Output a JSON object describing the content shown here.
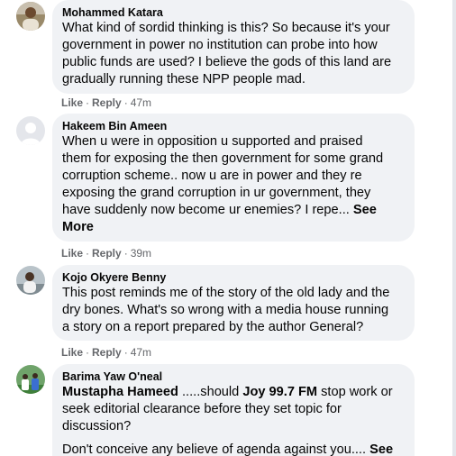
{
  "comments": [
    {
      "author": "Mohammed Katara",
      "avatar": "profile-photo-icon",
      "lines": [
        "What kind of sordid thinking is this? So because it's your",
        "government in power no institution can probe into how",
        "public funds are used? I believe the gods of this land are",
        "gradually running these NPP people mad."
      ],
      "like_label": "Like",
      "reply_label": "Reply",
      "time": "47m"
    },
    {
      "author": "Hakeem Bin Ameen",
      "avatar": "default-avatar-icon",
      "lines": [
        "When u were in opposition u supported and praised",
        "them for exposing the then government for some grand",
        "corruption scheme.. now u are in power and they re",
        "exposing the grand corruption in ur government, they",
        "have suddenly now become ur enemies? I repe..."
      ],
      "see_more_part1": "See",
      "see_more_part2": "More",
      "like_label": "Like",
      "reply_label": "Reply",
      "time": "39m"
    },
    {
      "author": "Kojo Okyere Benny",
      "avatar": "profile-photo-icon",
      "lines": [
        "This post reminds me of the story of the old lady and the",
        "dry bones. What's so wrong with a media house running",
        "a story on a report prepared by the author General?"
      ],
      "like_label": "Like",
      "reply_label": "Reply",
      "time": "47m"
    },
    {
      "author": "Barima Yaw O'neal",
      "avatar": "profile-photo-icon",
      "mention": "Mustapha Hameed",
      "line1_rest": " .....should ",
      "line1_bold": "Joy 99.7 FM",
      "line1_end": " stop work or",
      "lines": [
        "seek editorial clearance before they set topic for",
        "discussion?"
      ],
      "last_line": "Don't conceive any believe of agenda against you....",
      "see_more_part1": "See"
    }
  ],
  "separator": "·"
}
